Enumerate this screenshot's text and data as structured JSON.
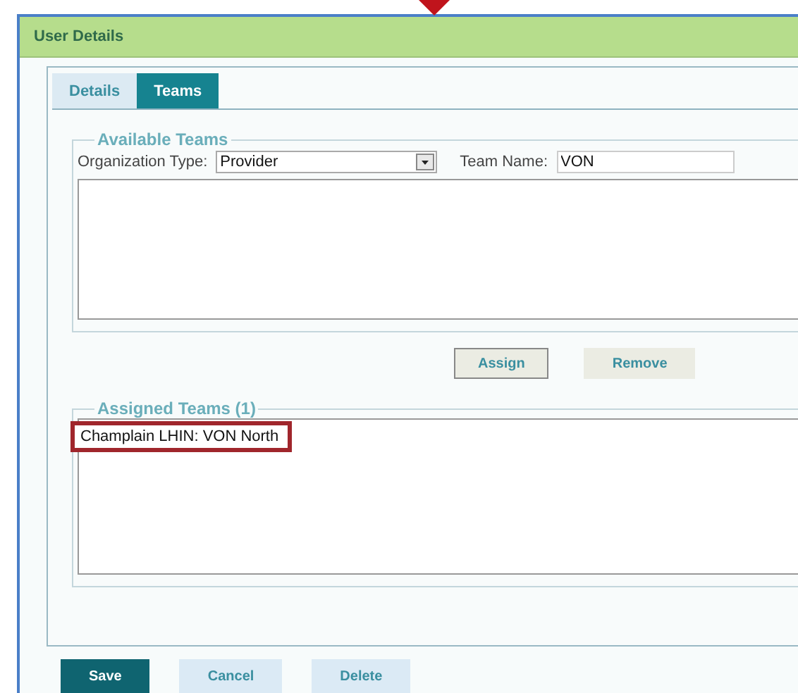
{
  "window": {
    "title": "User Details"
  },
  "tabs": [
    {
      "label": "Details",
      "selected": false
    },
    {
      "label": "Teams",
      "selected": true
    }
  ],
  "available_teams": {
    "legend": "Available Teams",
    "organization_type_label": "Organization Type:",
    "organization_type_value": "Provider",
    "team_name_label": "Team Name:",
    "team_name_value": "VON"
  },
  "list_buttons": [
    {
      "label": "Assign",
      "kind": "outlined"
    },
    {
      "label": "Remove",
      "kind": "flat"
    }
  ],
  "assigned_teams": {
    "legend": "Assigned Teams (1)",
    "items": [
      {
        "label": "Champlain LHIN: VON North",
        "highlighted": true
      }
    ]
  },
  "footer_buttons": [
    {
      "label": "Save",
      "kind": "primary"
    },
    {
      "label": "Cancel",
      "kind": "secondary"
    },
    {
      "label": "Delete",
      "kind": "secondary"
    }
  ]
}
